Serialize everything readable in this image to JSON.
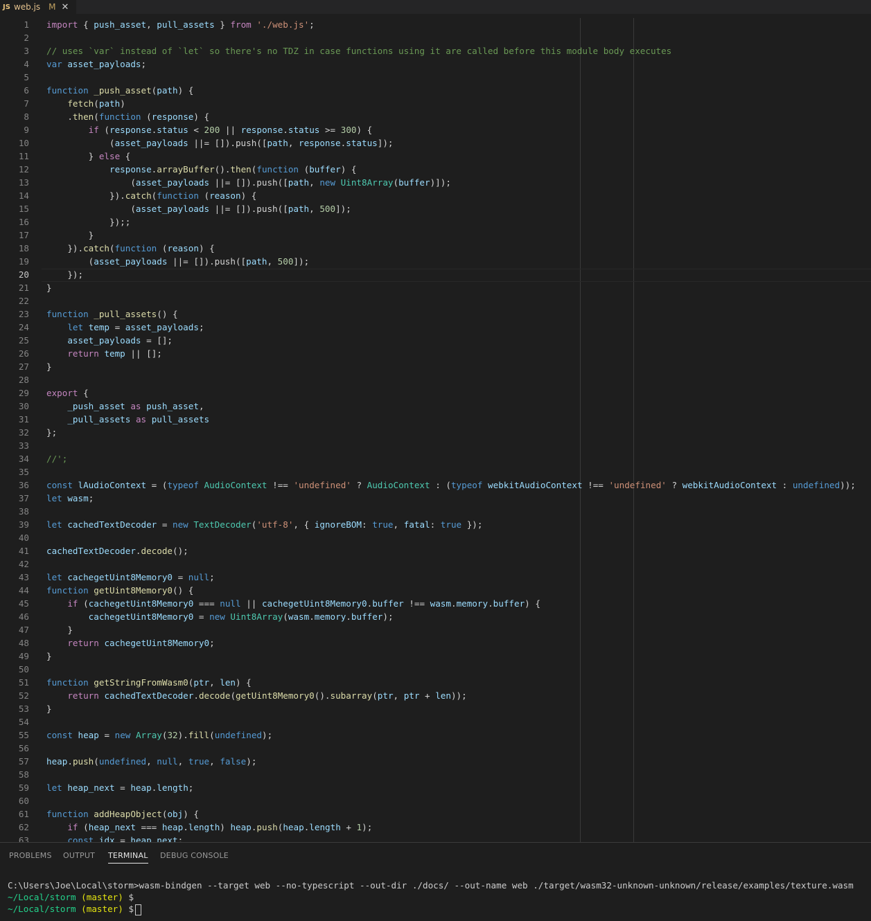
{
  "tab": {
    "icon": "JS",
    "filename": "web.js",
    "modified": "M",
    "close": "✕"
  },
  "editor": {
    "current_line": 20,
    "lines": [
      [
        [
          "k",
          "import"
        ],
        [
          "p",
          " { "
        ],
        [
          "v",
          "push_asset"
        ],
        [
          "p",
          ", "
        ],
        [
          "v",
          "pull_assets"
        ],
        [
          "p",
          " } "
        ],
        [
          "k",
          "from"
        ],
        [
          "p",
          " "
        ],
        [
          "str",
          "'./web.js'"
        ],
        [
          "p",
          ";"
        ]
      ],
      [],
      [
        [
          "c",
          "// uses `var` instead of `let` so there's no TDZ in case functions using it are called before this module body executes"
        ]
      ],
      [
        [
          "s",
          "var"
        ],
        [
          "p",
          " "
        ],
        [
          "v",
          "asset_payloads"
        ],
        [
          "p",
          ";"
        ]
      ],
      [],
      [
        [
          "s",
          "function"
        ],
        [
          "p",
          " "
        ],
        [
          "f",
          "_push_asset"
        ],
        [
          "p",
          "("
        ],
        [
          "v",
          "path"
        ],
        [
          "p",
          ") {"
        ]
      ],
      [
        [
          "p",
          "    "
        ],
        [
          "f",
          "fetch"
        ],
        [
          "p",
          "("
        ],
        [
          "v",
          "path"
        ],
        [
          "p",
          ")"
        ]
      ],
      [
        [
          "p",
          "    ."
        ],
        [
          "f",
          "then"
        ],
        [
          "p",
          "("
        ],
        [
          "s",
          "function"
        ],
        [
          "p",
          " ("
        ],
        [
          "v",
          "response"
        ],
        [
          "p",
          ") {"
        ]
      ],
      [
        [
          "p",
          "        "
        ],
        [
          "k",
          "if"
        ],
        [
          "p",
          " ("
        ],
        [
          "v",
          "response"
        ],
        [
          "p",
          "."
        ],
        [
          "v",
          "status"
        ],
        [
          "p",
          " < "
        ],
        [
          "n",
          "200"
        ],
        [
          "p",
          " || "
        ],
        [
          "v",
          "response"
        ],
        [
          "p",
          "."
        ],
        [
          "v",
          "status"
        ],
        [
          "p",
          " >= "
        ],
        [
          "n",
          "300"
        ],
        [
          "p",
          ") {"
        ]
      ],
      [
        [
          "p",
          "            ("
        ],
        [
          "v",
          "asset_payloads"
        ],
        [
          "p",
          " ||= []).push(["
        ],
        [
          "v",
          "path"
        ],
        [
          "p",
          ", "
        ],
        [
          "v",
          "response"
        ],
        [
          "p",
          "."
        ],
        [
          "v",
          "status"
        ],
        [
          "p",
          "]);"
        ]
      ],
      [
        [
          "p",
          "        } "
        ],
        [
          "k",
          "else"
        ],
        [
          "p",
          " {"
        ]
      ],
      [
        [
          "p",
          "            "
        ],
        [
          "v",
          "response"
        ],
        [
          "p",
          "."
        ],
        [
          "f",
          "arrayBuffer"
        ],
        [
          "p",
          "()."
        ],
        [
          "f",
          "then"
        ],
        [
          "p",
          "("
        ],
        [
          "s",
          "function"
        ],
        [
          "p",
          " ("
        ],
        [
          "v",
          "buffer"
        ],
        [
          "p",
          ") {"
        ]
      ],
      [
        [
          "p",
          "                ("
        ],
        [
          "v",
          "asset_payloads"
        ],
        [
          "p",
          " ||= []).push(["
        ],
        [
          "v",
          "path"
        ],
        [
          "p",
          ", "
        ],
        [
          "s",
          "new"
        ],
        [
          "p",
          " "
        ],
        [
          "cls",
          "Uint8Array"
        ],
        [
          "p",
          "("
        ],
        [
          "v",
          "buffer"
        ],
        [
          "p",
          ")]);"
        ]
      ],
      [
        [
          "p",
          "            })."
        ],
        [
          "f",
          "catch"
        ],
        [
          "p",
          "("
        ],
        [
          "s",
          "function"
        ],
        [
          "p",
          " ("
        ],
        [
          "v",
          "reason"
        ],
        [
          "p",
          ") {"
        ]
      ],
      [
        [
          "p",
          "                ("
        ],
        [
          "v",
          "asset_payloads"
        ],
        [
          "p",
          " ||= []).push(["
        ],
        [
          "v",
          "path"
        ],
        [
          "p",
          ", "
        ],
        [
          "n",
          "500"
        ],
        [
          "p",
          "]);"
        ]
      ],
      [
        [
          "p",
          "            });;"
        ]
      ],
      [
        [
          "p",
          "        }"
        ]
      ],
      [
        [
          "p",
          "    })."
        ],
        [
          "f",
          "catch"
        ],
        [
          "p",
          "("
        ],
        [
          "s",
          "function"
        ],
        [
          "p",
          " ("
        ],
        [
          "v",
          "reason"
        ],
        [
          "p",
          ") {"
        ]
      ],
      [
        [
          "p",
          "        ("
        ],
        [
          "v",
          "asset_payloads"
        ],
        [
          "p",
          " ||= []).push(["
        ],
        [
          "v",
          "path"
        ],
        [
          "p",
          ", "
        ],
        [
          "n",
          "500"
        ],
        [
          "p",
          "]);"
        ]
      ],
      [
        [
          "p",
          "    });"
        ]
      ],
      [
        [
          "p",
          "}"
        ]
      ],
      [],
      [
        [
          "s",
          "function"
        ],
        [
          "p",
          " "
        ],
        [
          "f",
          "_pull_assets"
        ],
        [
          "p",
          "() {"
        ]
      ],
      [
        [
          "p",
          "    "
        ],
        [
          "s",
          "let"
        ],
        [
          "p",
          " "
        ],
        [
          "v",
          "temp"
        ],
        [
          "p",
          " = "
        ],
        [
          "v",
          "asset_payloads"
        ],
        [
          "p",
          ";"
        ]
      ],
      [
        [
          "p",
          "    "
        ],
        [
          "v",
          "asset_payloads"
        ],
        [
          "p",
          " = [];"
        ]
      ],
      [
        [
          "p",
          "    "
        ],
        [
          "k",
          "return"
        ],
        [
          "p",
          " "
        ],
        [
          "v",
          "temp"
        ],
        [
          "p",
          " || [];"
        ]
      ],
      [
        [
          "p",
          "}"
        ]
      ],
      [],
      [
        [
          "k",
          "export"
        ],
        [
          "p",
          " {"
        ]
      ],
      [
        [
          "p",
          "    "
        ],
        [
          "v",
          "_push_asset"
        ],
        [
          "p",
          " "
        ],
        [
          "k",
          "as"
        ],
        [
          "p",
          " "
        ],
        [
          "v",
          "push_asset"
        ],
        [
          "p",
          ","
        ]
      ],
      [
        [
          "p",
          "    "
        ],
        [
          "v",
          "_pull_assets"
        ],
        [
          "p",
          " "
        ],
        [
          "k",
          "as"
        ],
        [
          "p",
          " "
        ],
        [
          "v",
          "pull_assets"
        ]
      ],
      [
        [
          "p",
          "};"
        ]
      ],
      [],
      [
        [
          "c",
          "//';"
        ]
      ],
      [],
      [
        [
          "s",
          "const"
        ],
        [
          "p",
          " "
        ],
        [
          "v",
          "lAudioContext"
        ],
        [
          "p",
          " = ("
        ],
        [
          "s",
          "typeof"
        ],
        [
          "p",
          " "
        ],
        [
          "cls",
          "AudioContext"
        ],
        [
          "p",
          " !== "
        ],
        [
          "str",
          "'undefined'"
        ],
        [
          "p",
          " ? "
        ],
        [
          "cls",
          "AudioContext"
        ],
        [
          "p",
          " : ("
        ],
        [
          "s",
          "typeof"
        ],
        [
          "p",
          " "
        ],
        [
          "v",
          "webkitAudioContext"
        ],
        [
          "p",
          " !== "
        ],
        [
          "str",
          "'undefined'"
        ],
        [
          "p",
          " ? "
        ],
        [
          "v",
          "webkitAudioContext"
        ],
        [
          "p",
          " : "
        ],
        [
          "s",
          "undefined"
        ],
        [
          "p",
          "));"
        ]
      ],
      [
        [
          "s",
          "let"
        ],
        [
          "p",
          " "
        ],
        [
          "v",
          "wasm"
        ],
        [
          "p",
          ";"
        ]
      ],
      [],
      [
        [
          "s",
          "let"
        ],
        [
          "p",
          " "
        ],
        [
          "v",
          "cachedTextDecoder"
        ],
        [
          "p",
          " = "
        ],
        [
          "s",
          "new"
        ],
        [
          "p",
          " "
        ],
        [
          "cls",
          "TextDecoder"
        ],
        [
          "p",
          "("
        ],
        [
          "str",
          "'utf-8'"
        ],
        [
          "p",
          ", { "
        ],
        [
          "v",
          "ignoreBOM"
        ],
        [
          "p",
          ": "
        ],
        [
          "s",
          "true"
        ],
        [
          "p",
          ", "
        ],
        [
          "v",
          "fatal"
        ],
        [
          "p",
          ": "
        ],
        [
          "s",
          "true"
        ],
        [
          "p",
          " });"
        ]
      ],
      [],
      [
        [
          "v",
          "cachedTextDecoder"
        ],
        [
          "p",
          "."
        ],
        [
          "f",
          "decode"
        ],
        [
          "p",
          "();"
        ]
      ],
      [],
      [
        [
          "s",
          "let"
        ],
        [
          "p",
          " "
        ],
        [
          "v",
          "cachegetUint8Memory0"
        ],
        [
          "p",
          " = "
        ],
        [
          "s",
          "null"
        ],
        [
          "p",
          ";"
        ]
      ],
      [
        [
          "s",
          "function"
        ],
        [
          "p",
          " "
        ],
        [
          "f",
          "getUint8Memory0"
        ],
        [
          "p",
          "() {"
        ]
      ],
      [
        [
          "p",
          "    "
        ],
        [
          "k",
          "if"
        ],
        [
          "p",
          " ("
        ],
        [
          "v",
          "cachegetUint8Memory0"
        ],
        [
          "p",
          " === "
        ],
        [
          "s",
          "null"
        ],
        [
          "p",
          " || "
        ],
        [
          "v",
          "cachegetUint8Memory0"
        ],
        [
          "p",
          "."
        ],
        [
          "v",
          "buffer"
        ],
        [
          "p",
          " !== "
        ],
        [
          "v",
          "wasm"
        ],
        [
          "p",
          "."
        ],
        [
          "v",
          "memory"
        ],
        [
          "p",
          "."
        ],
        [
          "v",
          "buffer"
        ],
        [
          "p",
          ") {"
        ]
      ],
      [
        [
          "p",
          "        "
        ],
        [
          "v",
          "cachegetUint8Memory0"
        ],
        [
          "p",
          " = "
        ],
        [
          "s",
          "new"
        ],
        [
          "p",
          " "
        ],
        [
          "cls",
          "Uint8Array"
        ],
        [
          "p",
          "("
        ],
        [
          "v",
          "wasm"
        ],
        [
          "p",
          "."
        ],
        [
          "v",
          "memory"
        ],
        [
          "p",
          "."
        ],
        [
          "v",
          "buffer"
        ],
        [
          "p",
          ");"
        ]
      ],
      [
        [
          "p",
          "    }"
        ]
      ],
      [
        [
          "p",
          "    "
        ],
        [
          "k",
          "return"
        ],
        [
          "p",
          " "
        ],
        [
          "v",
          "cachegetUint8Memory0"
        ],
        [
          "p",
          ";"
        ]
      ],
      [
        [
          "p",
          "}"
        ]
      ],
      [],
      [
        [
          "s",
          "function"
        ],
        [
          "p",
          " "
        ],
        [
          "f",
          "getStringFromWasm0"
        ],
        [
          "p",
          "("
        ],
        [
          "v",
          "ptr"
        ],
        [
          "p",
          ", "
        ],
        [
          "v",
          "len"
        ],
        [
          "p",
          ") {"
        ]
      ],
      [
        [
          "p",
          "    "
        ],
        [
          "k",
          "return"
        ],
        [
          "p",
          " "
        ],
        [
          "v",
          "cachedTextDecoder"
        ],
        [
          "p",
          "."
        ],
        [
          "f",
          "decode"
        ],
        [
          "p",
          "("
        ],
        [
          "f",
          "getUint8Memory0"
        ],
        [
          "p",
          "()."
        ],
        [
          "f",
          "subarray"
        ],
        [
          "p",
          "("
        ],
        [
          "v",
          "ptr"
        ],
        [
          "p",
          ", "
        ],
        [
          "v",
          "ptr"
        ],
        [
          "p",
          " + "
        ],
        [
          "v",
          "len"
        ],
        [
          "p",
          "));"
        ]
      ],
      [
        [
          "p",
          "}"
        ]
      ],
      [],
      [
        [
          "s",
          "const"
        ],
        [
          "p",
          " "
        ],
        [
          "v",
          "heap"
        ],
        [
          "p",
          " = "
        ],
        [
          "s",
          "new"
        ],
        [
          "p",
          " "
        ],
        [
          "cls",
          "Array"
        ],
        [
          "p",
          "("
        ],
        [
          "n",
          "32"
        ],
        [
          "p",
          ")."
        ],
        [
          "f",
          "fill"
        ],
        [
          "p",
          "("
        ],
        [
          "s",
          "undefined"
        ],
        [
          "p",
          ");"
        ]
      ],
      [],
      [
        [
          "v",
          "heap"
        ],
        [
          "p",
          "."
        ],
        [
          "f",
          "push"
        ],
        [
          "p",
          "("
        ],
        [
          "s",
          "undefined"
        ],
        [
          "p",
          ", "
        ],
        [
          "s",
          "null"
        ],
        [
          "p",
          ", "
        ],
        [
          "s",
          "true"
        ],
        [
          "p",
          ", "
        ],
        [
          "s",
          "false"
        ],
        [
          "p",
          ");"
        ]
      ],
      [],
      [
        [
          "s",
          "let"
        ],
        [
          "p",
          " "
        ],
        [
          "v",
          "heap_next"
        ],
        [
          "p",
          " = "
        ],
        [
          "v",
          "heap"
        ],
        [
          "p",
          "."
        ],
        [
          "v",
          "length"
        ],
        [
          "p",
          ";"
        ]
      ],
      [],
      [
        [
          "s",
          "function"
        ],
        [
          "p",
          " "
        ],
        [
          "f",
          "addHeapObject"
        ],
        [
          "p",
          "("
        ],
        [
          "v",
          "obj"
        ],
        [
          "p",
          ") {"
        ]
      ],
      [
        [
          "p",
          "    "
        ],
        [
          "k",
          "if"
        ],
        [
          "p",
          " ("
        ],
        [
          "v",
          "heap_next"
        ],
        [
          "p",
          " === "
        ],
        [
          "v",
          "heap"
        ],
        [
          "p",
          "."
        ],
        [
          "v",
          "length"
        ],
        [
          "p",
          ") "
        ],
        [
          "v",
          "heap"
        ],
        [
          "p",
          "."
        ],
        [
          "f",
          "push"
        ],
        [
          "p",
          "("
        ],
        [
          "v",
          "heap"
        ],
        [
          "p",
          "."
        ],
        [
          "v",
          "length"
        ],
        [
          "p",
          " + "
        ],
        [
          "n",
          "1"
        ],
        [
          "p",
          ");"
        ]
      ],
      [
        [
          "p",
          "    "
        ],
        [
          "s",
          "const"
        ],
        [
          "p",
          " "
        ],
        [
          "v",
          "idx"
        ],
        [
          "p",
          " = "
        ],
        [
          "v",
          "heap_next"
        ],
        [
          "p",
          ";"
        ]
      ]
    ]
  },
  "panel": {
    "tabs": [
      "PROBLEMS",
      "OUTPUT",
      "TERMINAL",
      "DEBUG CONSOLE"
    ],
    "active_tab": "TERMINAL",
    "terminal": {
      "command": "C:\\Users\\Joe\\Local\\storm>wasm-bindgen --target web --no-typescript --out-dir ./docs/ --out-name web ./target/wasm32-unknown-unknown/release/examples/texture.wasm",
      "prompt_path": "~/Local/storm",
      "prompt_branch": "(master)",
      "prompt_symbol": "$"
    }
  }
}
